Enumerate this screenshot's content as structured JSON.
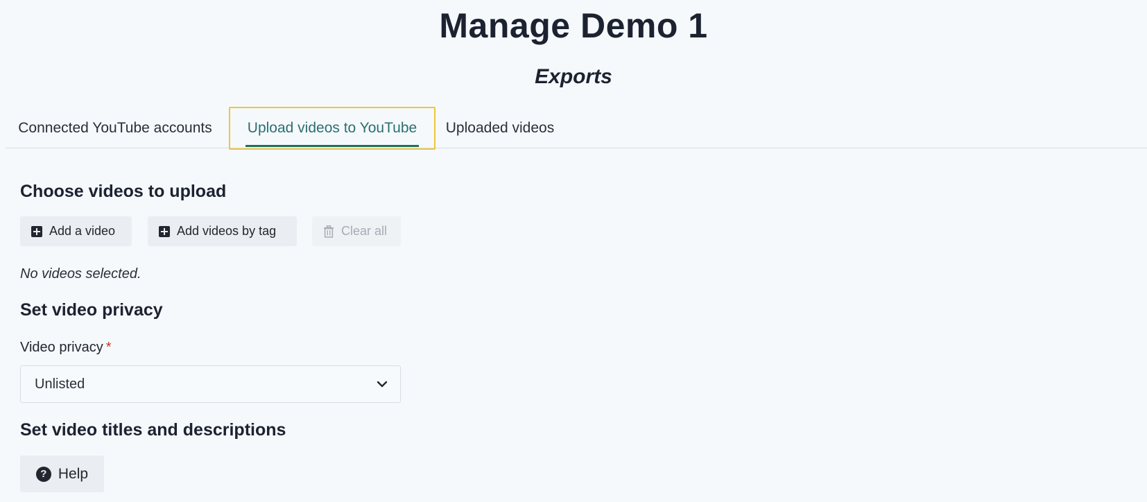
{
  "header": {
    "title": "Manage Demo 1",
    "section": "Exports"
  },
  "tabs": [
    {
      "label": "Connected YouTube accounts",
      "active": false
    },
    {
      "label": "Upload videos to YouTube",
      "active": true
    },
    {
      "label": "Uploaded videos",
      "active": false
    }
  ],
  "choose": {
    "heading": "Choose videos to upload",
    "add_video_label": "Add a video",
    "add_by_tag_label": "Add videos by tag",
    "clear_all_label": "Clear all",
    "empty_text": "No videos selected."
  },
  "privacy": {
    "heading": "Set video privacy",
    "field_label": "Video privacy",
    "required_mark": "*",
    "selected_value": "Unlisted"
  },
  "titles": {
    "heading": "Set video titles and descriptions",
    "help_label": "Help"
  },
  "icons": {
    "add_video": "plus-square-icon",
    "add_by_tag": "plus-square-icon",
    "clear_all": "trash-icon",
    "select": "chevron-down-icon",
    "help": "question-circle-icon"
  },
  "colors": {
    "background": "#f5f9fc",
    "active_tab_text": "#2b6f6f",
    "active_tab_underline": "#1f6f5a",
    "focus_outline": "#f0c53a",
    "required": "#c0392b"
  }
}
